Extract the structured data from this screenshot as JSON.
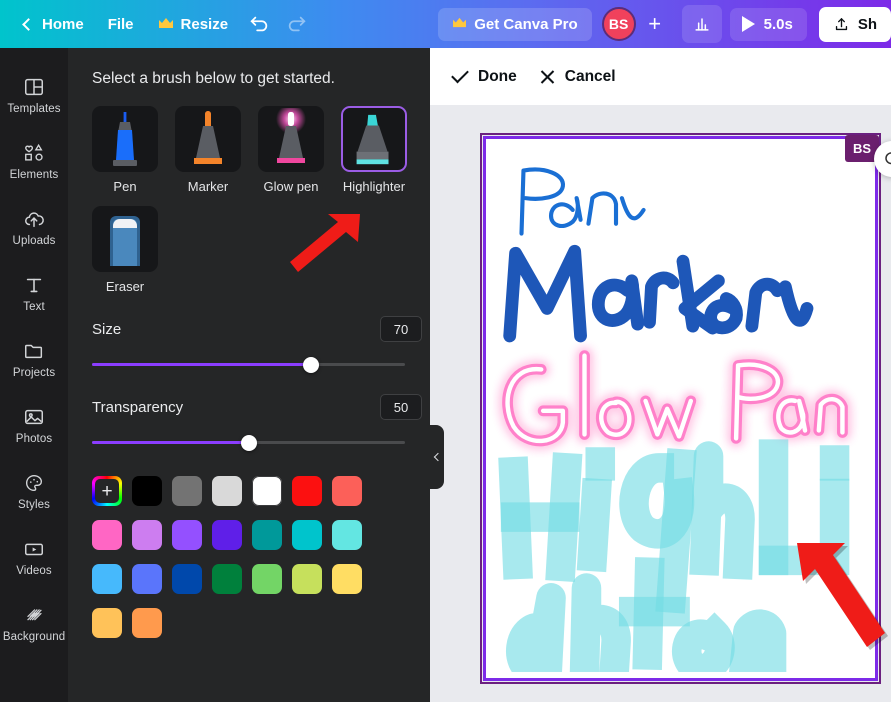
{
  "topbar": {
    "back_icon": "chevron-left-icon",
    "home_label": "Home",
    "file_label": "File",
    "resize_label": "Resize",
    "resize_icon": "crown-icon",
    "undo_icon": "undo-icon",
    "redo_icon": "redo-icon",
    "pro_label": "Get Canva Pro",
    "pro_icon": "crown-icon",
    "avatar_initials": "BS",
    "add_collaborator_label": "+",
    "analytics_icon": "bar-chart-icon",
    "play_icon": "play-icon",
    "duration_label": "5.0s",
    "share_icon": "share-upload-icon",
    "share_label": "Sh"
  },
  "sidebar": {
    "items": [
      {
        "label": "Templates",
        "icon": "templates-icon"
      },
      {
        "label": "Elements",
        "icon": "elements-icon"
      },
      {
        "label": "Uploads",
        "icon": "uploads-cloud-icon"
      },
      {
        "label": "Text",
        "icon": "text-t-icon"
      },
      {
        "label": "Projects",
        "icon": "folder-icon"
      },
      {
        "label": "Photos",
        "icon": "photo-icon"
      },
      {
        "label": "Styles",
        "icon": "palette-icon"
      },
      {
        "label": "Videos",
        "icon": "video-icon"
      },
      {
        "label": "Background",
        "icon": "background-hatch-icon"
      }
    ]
  },
  "panel": {
    "title": "Select a brush below to get started.",
    "brushes": [
      {
        "name": "Pen",
        "icon": "pen-brush-icon",
        "selected": false
      },
      {
        "name": "Marker",
        "icon": "marker-brush-icon",
        "selected": false
      },
      {
        "name": "Glow pen",
        "icon": "glow-pen-brush-icon",
        "selected": false
      },
      {
        "name": "Highlighter",
        "icon": "highlighter-brush-icon",
        "selected": true
      },
      {
        "name": "Eraser",
        "icon": "eraser-brush-icon",
        "selected": false
      }
    ],
    "size": {
      "label": "Size",
      "value": "70",
      "percent": 70
    },
    "transparency": {
      "label": "Transparency",
      "value": "50",
      "percent": 50
    },
    "slider_accent": "#8b3dff",
    "palette": {
      "add_swatch": {
        "name": "add-custom-color",
        "glyph": "+"
      },
      "colors": [
        "#000000",
        "#737373",
        "#d9d9d9",
        "#ffffff",
        "#fc1010",
        "#fc6059",
        "#ff66c4",
        "#cd7df0",
        "#9450ff",
        "#5f1fe8",
        "#00999a",
        "#00c4cc",
        "#63e6e2",
        "#46b9fc",
        "#5a75fb",
        "#0048ab",
        "#00803c",
        "#73d566",
        "#c6e05c",
        "#ffdd63",
        "#ffc259",
        "#ff9a4d"
      ]
    },
    "collapse_icon": "chevron-left-icon"
  },
  "editor": {
    "done_label": "Done",
    "done_icon": "check-icon",
    "cancel_label": "Cancel",
    "cancel_icon": "close-x-icon",
    "page_badge": "BS",
    "page_border_color": "#7d2ae8",
    "round_button_icon": "zoom-icon",
    "drawing": {
      "strokes": [
        {
          "text": "Pen",
          "brush": "Pen",
          "color": "#1a6fd4"
        },
        {
          "text": "Marker",
          "brush": "Marker",
          "color": "#1e57b8"
        },
        {
          "text": "Glow Pen",
          "brush": "Glow pen",
          "color": "#ff8fd4"
        },
        {
          "text": "Highlighter",
          "brush": "Highlighter",
          "color": "#7fdde3"
        }
      ],
      "annotation_arrow_color": "#ef1c18"
    }
  },
  "annotations": {
    "arrow_color": "#ef1c18",
    "arrow_target": "Highlighter"
  }
}
